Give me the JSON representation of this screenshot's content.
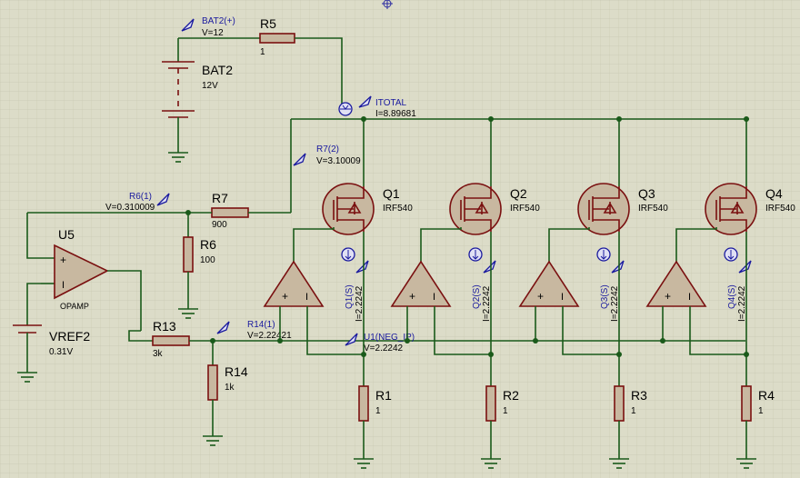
{
  "probes": {
    "bat2": {
      "name": "BAT2(+)",
      "value": "V=12"
    },
    "itotal": {
      "name": "ITOTAL",
      "value": "I=8.89681"
    },
    "r7": {
      "name": "R7(2)",
      "value": "V=3.10009"
    },
    "r6": {
      "name": "R6(1)",
      "value": "V=0.310009"
    },
    "r14": {
      "name": "R14(1)",
      "value": "V=2.22421"
    },
    "u1neg": {
      "name": "U1(NEG_IP)",
      "value": "V=2.2242"
    }
  },
  "components": {
    "r5": {
      "ref": "R5",
      "value": "1"
    },
    "bat2": {
      "ref": "BAT2",
      "value": "12V"
    },
    "r7": {
      "ref": "R7",
      "value": "900"
    },
    "r6": {
      "ref": "R6",
      "value": "100"
    },
    "u5": {
      "ref": "U5",
      "value": "OPAMP"
    },
    "vref2": {
      "ref": "VREF2",
      "value": "0.31V"
    },
    "r13": {
      "ref": "R13",
      "value": "3k"
    },
    "r14": {
      "ref": "R14",
      "value": "1k"
    }
  },
  "mosfets": [
    {
      "ref": "Q1",
      "part": "IRF540",
      "probe": "Q1(S)",
      "current": "I=2.2242"
    },
    {
      "ref": "Q2",
      "part": "IRF540",
      "probe": "Q2(S)",
      "current": "I=2.2242"
    },
    {
      "ref": "Q3",
      "part": "IRF540",
      "probe": "Q3(S)",
      "current": "I=2.2242"
    },
    {
      "ref": "Q4",
      "part": "IRF540",
      "probe": "Q4(S)",
      "current": "I=2.2242"
    }
  ],
  "source_resistors": [
    {
      "ref": "R1",
      "value": "1"
    },
    {
      "ref": "R2",
      "value": "1"
    },
    {
      "ref": "R3",
      "value": "1"
    },
    {
      "ref": "R4",
      "value": "1"
    }
  ],
  "opamp_pins": {
    "plus": "+",
    "minus": "I"
  },
  "colors": {
    "background": "#dcdcc8",
    "wire": "#1a5a1a",
    "component": "#7a1010",
    "probe": "#1a1a9e"
  }
}
